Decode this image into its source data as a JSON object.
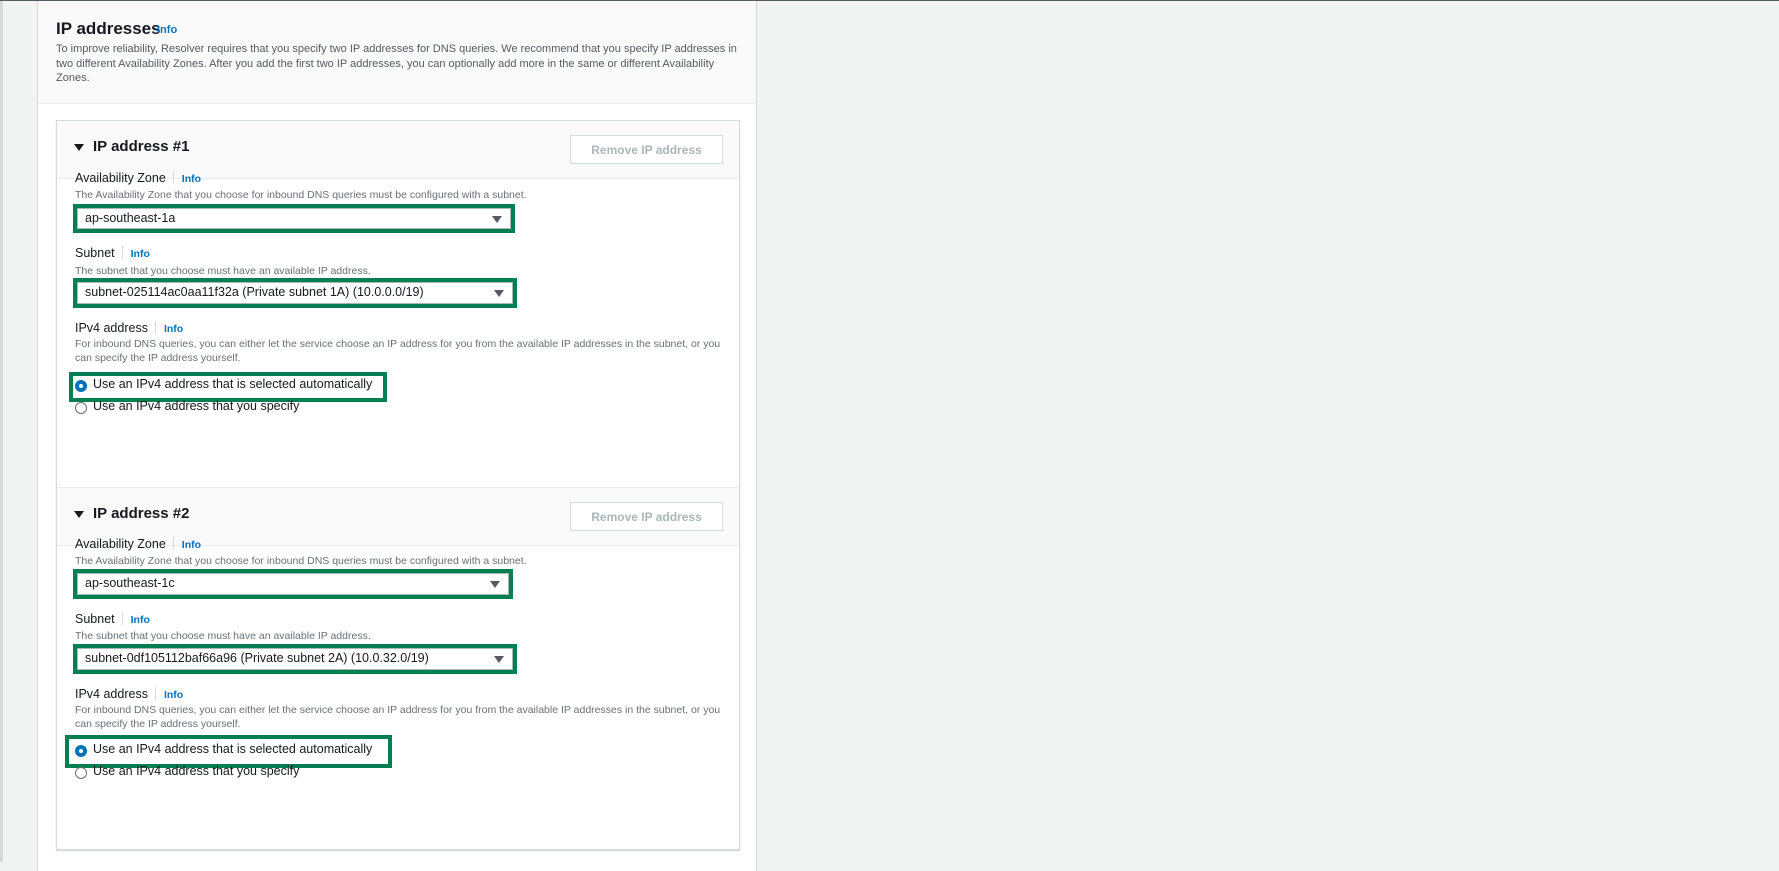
{
  "section": {
    "title": "IP addresses",
    "info_label": "Info",
    "description": "To improve reliability, Resolver requires that you specify two IP addresses for DNS queries. We recommend that you specify IP addresses in two different Availability Zones. After you add the first two IP addresses, you can optionally add more in the same or different Availability Zones."
  },
  "ip_addresses": [
    {
      "title": "IP address #1",
      "remove_label": "Remove IP address",
      "availability_zone": {
        "label": "Availability Zone",
        "info_label": "Info",
        "description": "The Availability Zone that you choose for inbound DNS queries must be configured with a subnet.",
        "value": "ap-southeast-1a"
      },
      "subnet": {
        "label": "Subnet",
        "info_label": "Info",
        "description": "The subnet that you choose must have an available IP address.",
        "value": "subnet-025114ac0aa11f32a (Private subnet 1A) (10.0.0.0/19)"
      },
      "ipv4": {
        "label": "IPv4 address",
        "info_label": "Info",
        "description": "For inbound DNS queries, you can either let the service choose an IP address for you from the available IP addresses in the subnet, or you can specify the IP address yourself.",
        "options": [
          {
            "label": "Use an IPv4 address that is selected automatically",
            "checked": true
          },
          {
            "label": "Use an IPv4 address that you specify",
            "checked": false
          }
        ]
      }
    },
    {
      "title": "IP address #2",
      "remove_label": "Remove IP address",
      "availability_zone": {
        "label": "Availability Zone",
        "info_label": "Info",
        "description": "The Availability Zone that you choose for inbound DNS queries must be configured with a subnet.",
        "value": "ap-southeast-1c"
      },
      "subnet": {
        "label": "Subnet",
        "info_label": "Info",
        "description": "The subnet that you choose must have an available IP address.",
        "value": "subnet-0df105112baf66a96 (Private subnet 2A) (10.0.32.0/19)"
      },
      "ipv4": {
        "label": "IPv4 address",
        "info_label": "Info",
        "description": "For inbound DNS queries, you can either let the service choose an IP address for you from the available IP addresses in the subnet, or you can specify the IP address yourself.",
        "options": [
          {
            "label": "Use an IPv4 address that is selected automatically",
            "checked": true
          },
          {
            "label": "Use an IPv4 address that you specify",
            "checked": false
          }
        ]
      }
    }
  ],
  "colors": {
    "highlight": "#037f51",
    "link": "#0073bb",
    "radio_selected": "#0073bb",
    "disabled_text": "#aab7b8"
  }
}
